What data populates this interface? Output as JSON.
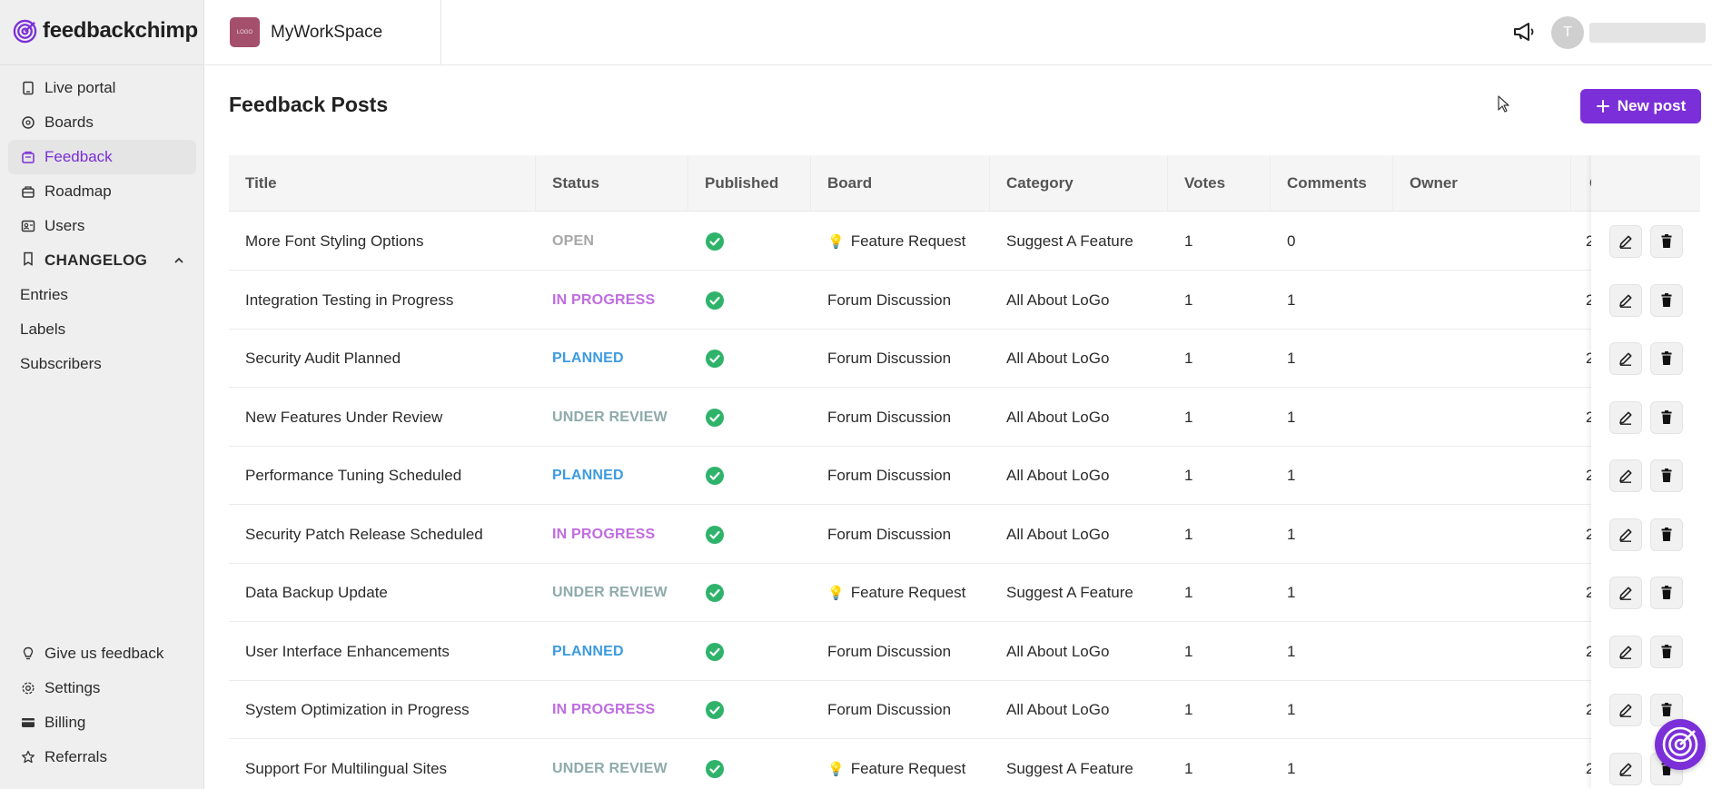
{
  "brand": {
    "name": "feedbackchimp"
  },
  "workspace": {
    "name": "MyWorkSpace",
    "logo_text": "LOGO"
  },
  "user": {
    "initial": "T"
  },
  "sidebar": {
    "items": [
      {
        "label": "Live portal",
        "icon": "portal-icon"
      },
      {
        "label": "Boards",
        "icon": "boards-icon"
      },
      {
        "label": "Feedback",
        "icon": "feedback-icon",
        "active": true
      },
      {
        "label": "Roadmap",
        "icon": "roadmap-icon"
      },
      {
        "label": "Users",
        "icon": "users-icon"
      }
    ],
    "changelog": {
      "label": "CHANGELOG",
      "items": [
        "Entries",
        "Labels",
        "Subscribers"
      ]
    },
    "bottom": [
      {
        "label": "Give us feedback",
        "icon": "bulb-icon"
      },
      {
        "label": "Settings",
        "icon": "gear-icon"
      },
      {
        "label": "Billing",
        "icon": "card-icon"
      },
      {
        "label": "Referrals",
        "icon": "star-icon"
      }
    ]
  },
  "page": {
    "title": "Feedback Posts",
    "new_post_label": "New post"
  },
  "table": {
    "columns": [
      "Title",
      "Status",
      "Published",
      "Board",
      "Category",
      "Votes",
      "Comments",
      "Owner",
      "C"
    ],
    "rows": [
      {
        "title": "More Font Styling Options",
        "status": "OPEN",
        "board": "Feature Request",
        "category": "Suggest A Feature",
        "votes": "1",
        "comments": "0",
        "partial": "2"
      },
      {
        "title": "Integration Testing in Progress",
        "status": "IN PROGRESS",
        "board": "Forum Discussion",
        "category": "All About LoGo",
        "votes": "1",
        "comments": "1",
        "partial": "2"
      },
      {
        "title": "Security Audit Planned",
        "status": "PLANNED",
        "board": "Forum Discussion",
        "category": "All About LoGo",
        "votes": "1",
        "comments": "1",
        "partial": "2"
      },
      {
        "title": "New Features Under Review",
        "status": "UNDER REVIEW",
        "board": "Forum Discussion",
        "category": "All About LoGo",
        "votes": "1",
        "comments": "1",
        "partial": "2"
      },
      {
        "title": "Performance Tuning Scheduled",
        "status": "PLANNED",
        "board": "Forum Discussion",
        "category": "All About LoGo",
        "votes": "1",
        "comments": "1",
        "partial": "2"
      },
      {
        "title": "Security Patch Release Scheduled",
        "status": "IN PROGRESS",
        "board": "Forum Discussion",
        "category": "All About LoGo",
        "votes": "1",
        "comments": "1",
        "partial": "2"
      },
      {
        "title": "Data Backup Update",
        "status": "UNDER REVIEW",
        "board": "Feature Request",
        "category": "Suggest A Feature",
        "votes": "1",
        "comments": "1",
        "partial": "2"
      },
      {
        "title": "User Interface Enhancements",
        "status": "PLANNED",
        "board": "Forum Discussion",
        "category": "All About LoGo",
        "votes": "1",
        "comments": "1",
        "partial": "2"
      },
      {
        "title": "System Optimization in Progress",
        "status": "IN PROGRESS",
        "board": "Forum Discussion",
        "category": "All About LoGo",
        "votes": "1",
        "comments": "1",
        "partial": "2"
      },
      {
        "title": "Support For Multilingual Sites",
        "status": "UNDER REVIEW",
        "board": "Feature Request",
        "category": "Suggest A Feature",
        "votes": "1",
        "comments": "1",
        "partial": "2"
      }
    ]
  },
  "status_colors": {
    "OPEN": "#a7a7a7",
    "IN PROGRESS": "#c06ce0",
    "PLANNED": "#3d9be0",
    "UNDER REVIEW": "#8eaaaa"
  },
  "colors": {
    "accent": "#7b2fd8",
    "published": "#2fb36b"
  }
}
